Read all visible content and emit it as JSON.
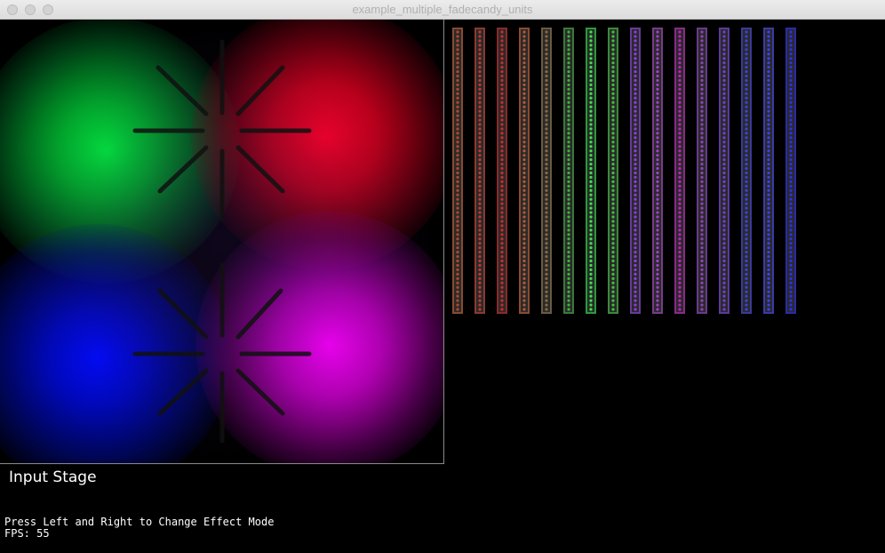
{
  "window": {
    "title": "example_multiple_fadecandy_units"
  },
  "icons": {
    "close": "close-icon",
    "minimize": "minimize-icon",
    "maximize": "maximize-icon"
  },
  "input_stage": {
    "label": "Input Stage",
    "blob_colors": [
      "#00f03c",
      "#ff0028",
      "#000aff",
      "#ff00ff"
    ]
  },
  "help": {
    "instructions": "Press Left and Right to Change Effect Mode",
    "fps": "FPS: 55"
  },
  "led_strips": [
    {
      "color": "#8a4a30",
      "led_color": "#b04a30"
    },
    {
      "color": "#8a3a30",
      "led_color": "#c03a30"
    },
    {
      "color": "#8a2a2a",
      "led_color": "#d02a2a"
    },
    {
      "color": "#8a4a30",
      "led_color": "#b05a3a"
    },
    {
      "color": "#6a5a40",
      "led_color": "#8a6a40"
    },
    {
      "color": "#3a7a3a",
      "led_color": "#40b040"
    },
    {
      "color": "#2a9a3a",
      "led_color": "#40e050"
    },
    {
      "color": "#3a8a3a",
      "led_color": "#40c040"
    },
    {
      "color": "#6a3a9a",
      "led_color": "#8a40e0"
    },
    {
      "color": "#7a3a8a",
      "led_color": "#a040d0"
    },
    {
      "color": "#8a2a8a",
      "led_color": "#c020c0"
    },
    {
      "color": "#6a3a8a",
      "led_color": "#9040c0"
    },
    {
      "color": "#5a3a9a",
      "led_color": "#7040d0"
    },
    {
      "color": "#3a3a9a",
      "led_color": "#4040e0"
    },
    {
      "color": "#3a3aaa",
      "led_color": "#4040f0"
    },
    {
      "color": "#2a2aaa",
      "led_color": "#3030f0"
    }
  ]
}
